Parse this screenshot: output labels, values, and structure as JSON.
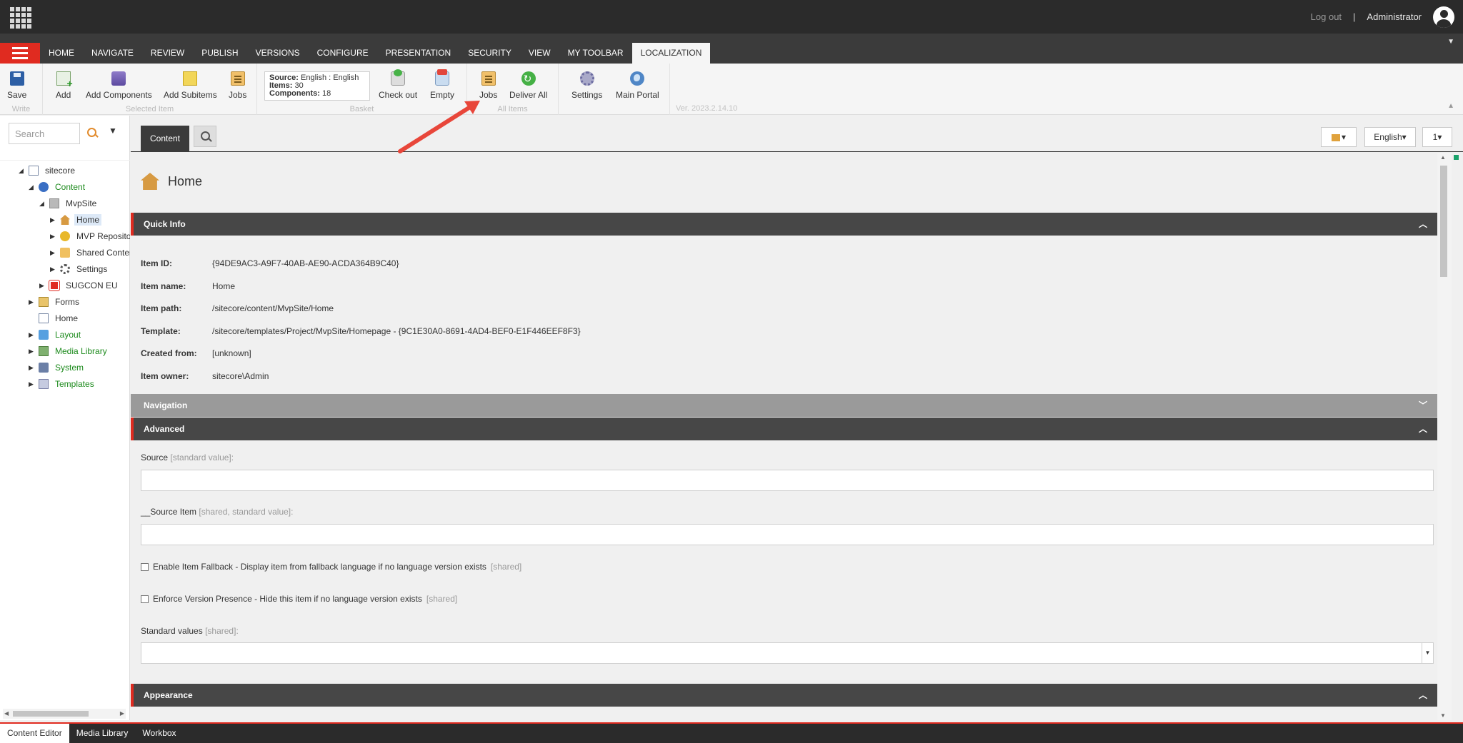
{
  "topbar": {
    "logout": "Log out",
    "separator": "|",
    "user": "Administrator"
  },
  "ribbon_tabs": [
    "HOME",
    "NAVIGATE",
    "REVIEW",
    "PUBLISH",
    "VERSIONS",
    "CONFIGURE",
    "PRESENTATION",
    "SECURITY",
    "VIEW",
    "MY TOOLBAR",
    "LOCALIZATION"
  ],
  "ribbon": {
    "write": {
      "name": "Write",
      "save": "Save"
    },
    "selected_item": {
      "name": "Selected Item",
      "add": "Add",
      "add_components": "Add Components",
      "add_subitems": "Add Subitems",
      "jobs": "Jobs"
    },
    "basket": {
      "name": "Basket",
      "source_label": "Source:",
      "source_value": "English : English",
      "items_label": "Items:",
      "items_value": "30",
      "components_label": "Components:",
      "components_value": "18",
      "check_out": "Check out",
      "empty": "Empty"
    },
    "all_items": {
      "name": "All Items",
      "jobs": "Jobs",
      "deliver_all": "Deliver All"
    },
    "other": {
      "settings": "Settings",
      "main_portal": "Main Portal"
    },
    "version": "Ver. 2023.2.14.10"
  },
  "search": {
    "placeholder": "Search"
  },
  "tree": [
    {
      "label": "sitecore",
      "arrow": "◢"
    },
    {
      "label": "Content",
      "arrow": "◢"
    },
    {
      "label": "MvpSite",
      "arrow": "◢"
    },
    {
      "label": "Home",
      "arrow": "▶"
    },
    {
      "label": "MVP Repository",
      "arrow": "▶"
    },
    {
      "label": "Shared Content",
      "arrow": "▶"
    },
    {
      "label": "Settings",
      "arrow": "▶"
    },
    {
      "label": "SUGCON EU",
      "arrow": "▶"
    },
    {
      "label": "Forms",
      "arrow": "▶"
    },
    {
      "label": "Home",
      "arrow": ""
    },
    {
      "label": "Layout",
      "arrow": "▶"
    },
    {
      "label": "Media Library",
      "arrow": "▶"
    },
    {
      "label": "System",
      "arrow": "▶"
    },
    {
      "label": "Templates",
      "arrow": "▶"
    }
  ],
  "content_tabs": {
    "content": "Content"
  },
  "view_buttons": {
    "language": "English",
    "version": "1"
  },
  "item": {
    "title": "Home"
  },
  "quick_info": {
    "title": "Quick Info",
    "rows": [
      {
        "label": "Item ID:",
        "value": "{94DE9AC3-A9F7-40AB-AE90-ACDA364B9C40}"
      },
      {
        "label": "Item name:",
        "value": "Home"
      },
      {
        "label": "Item path:",
        "value": "/sitecore/content/MvpSite/Home"
      },
      {
        "label": "Template:",
        "value": "/sitecore/templates/Project/MvpSite/Homepage - {9C1E30A0-8691-4AD4-BEF0-E1F446EEF8F3}"
      },
      {
        "label": "Created from:",
        "value": "[unknown]"
      },
      {
        "label": "Item owner:",
        "value": "sitecore\\Admin"
      }
    ]
  },
  "sections": {
    "navigation": "Navigation",
    "advanced": "Advanced",
    "appearance": "Appearance"
  },
  "advanced_fields": {
    "source_label": "Source",
    "source_note": "[standard value]:",
    "source_item_label": "__Source Item",
    "source_item_note": "[shared, standard value]:",
    "fallback_label": "Enable Item Fallback - Display item from fallback language if no language version exists",
    "fallback_note": "[shared]",
    "enforce_label": "Enforce Version Presence - Hide this item if no language version exists",
    "enforce_note": "[shared]",
    "standard_values_label": "Standard values",
    "standard_values_note": "[shared]:"
  },
  "taskbar": [
    "Content Editor",
    "Media Library",
    "Workbox"
  ]
}
